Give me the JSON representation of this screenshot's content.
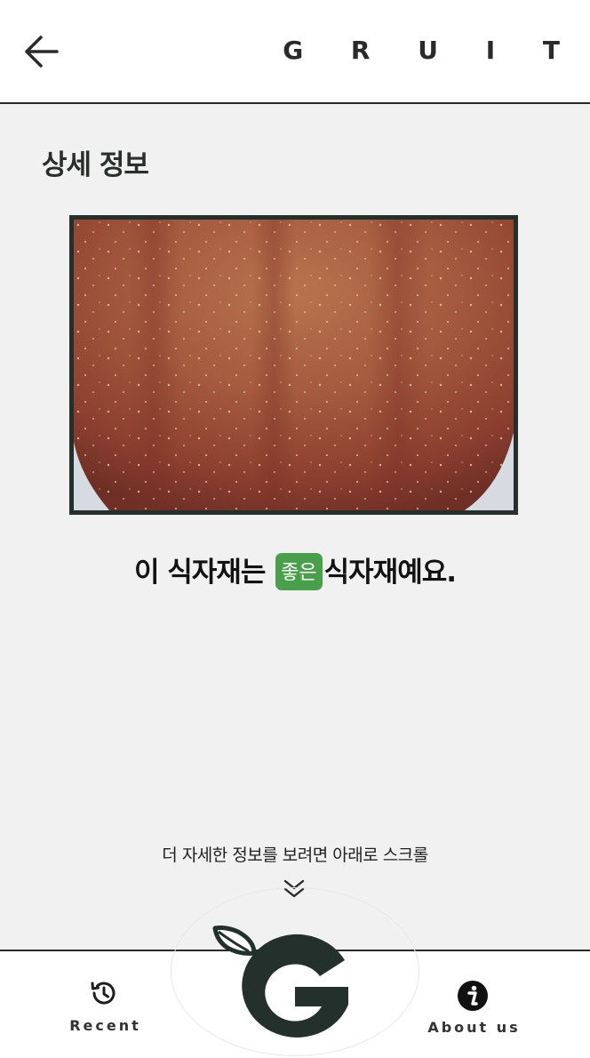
{
  "header": {
    "brand": "G R U I T",
    "back_icon": "arrow-left-icon"
  },
  "main": {
    "section_title": "상세 정보",
    "result": {
      "prefix": "이 식자재는",
      "badge": "좋은",
      "suffix": "식자재예요.",
      "badge_color": "#4aa04a"
    },
    "scroll_hint": "더 자세한 정보를 보려면 아래로 스크롤",
    "scroll_icon": "double-chevron-down-icon"
  },
  "bottom_nav": {
    "recent_label": "Recent",
    "recent_icon": "history-icon",
    "about_label": "About us",
    "about_icon": "info-icon",
    "logo_icon": "gruit-logo"
  },
  "colors": {
    "background": "#f1f1f1",
    "accent_dark": "#23302b",
    "good_green": "#4aa04a"
  }
}
